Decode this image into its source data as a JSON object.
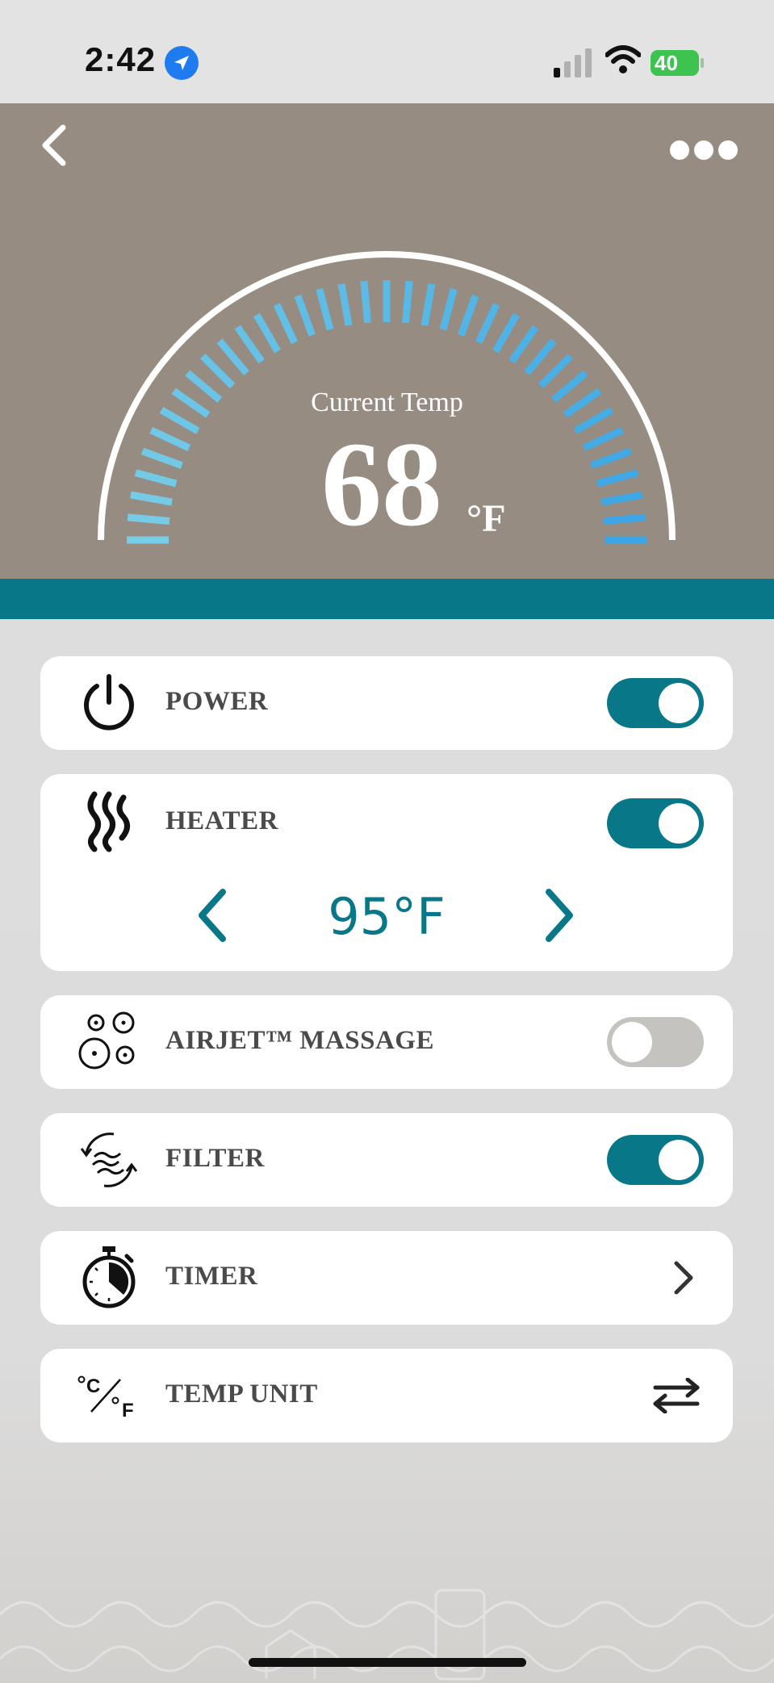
{
  "status_bar": {
    "time": "2:42",
    "battery": "40"
  },
  "gauge": {
    "label": "Current Temp",
    "value": "68",
    "unit": "°F"
  },
  "controls": {
    "power": {
      "label": "POWER",
      "on": true
    },
    "heater": {
      "label": "HEATER",
      "on": true,
      "setpoint": "95°F"
    },
    "airjet": {
      "label": "AIRJET™ MASSAGE",
      "on": false
    },
    "filter": {
      "label": "FILTER",
      "on": true
    },
    "timer": {
      "label": "TIMER"
    },
    "temp_unit": {
      "label": "TEMP UNIT"
    }
  },
  "icons": [
    "back-icon",
    "more-icon",
    "power-icon",
    "heat-waves-icon",
    "bubbles-icon",
    "filter-cycle-icon",
    "stopwatch-icon",
    "celsius-fahrenheit-icon",
    "chevron-left-icon",
    "chevron-right-icon",
    "swap-arrows-icon",
    "location-arrow-icon",
    "signal-icon",
    "wifi-icon",
    "battery-icon"
  ],
  "colors": {
    "accent": "#087888",
    "hero": "#968c82",
    "toggle_off": "#c4c3c0"
  }
}
